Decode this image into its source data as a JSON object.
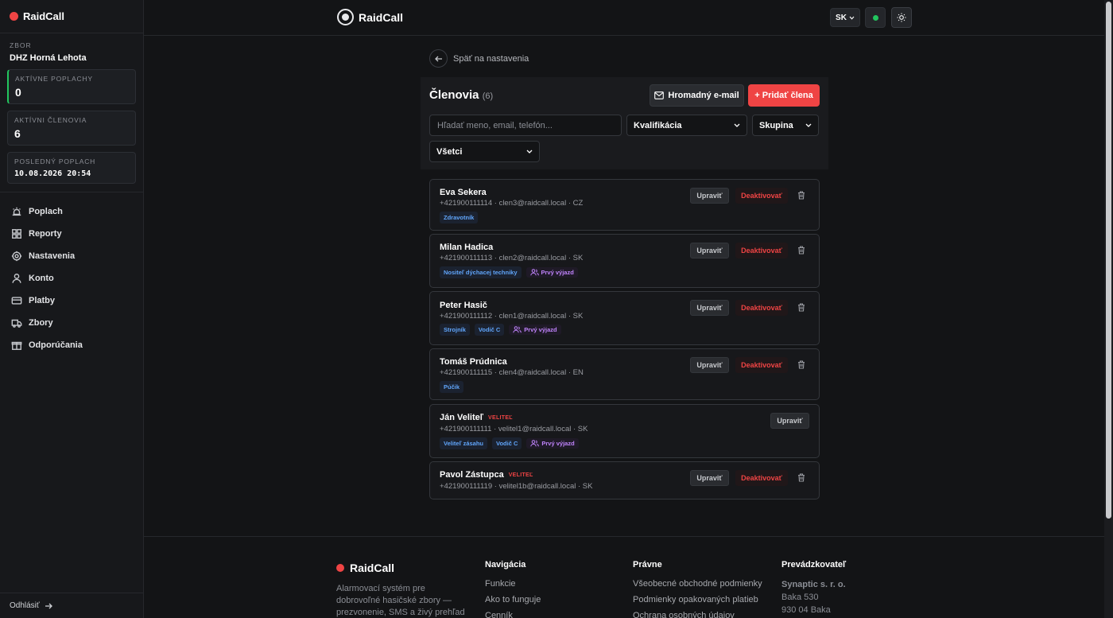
{
  "sidebar": {
    "brand": "RaidCall",
    "org_label": "ZBOR",
    "org_name": "DHZ Horná Lehota",
    "stats": [
      {
        "label": "AKTÍVNE POPLACHY",
        "value": "0"
      },
      {
        "label": "AKTÍVNI ČLENOVIA",
        "value": "6"
      },
      {
        "label": "POSLEDNÝ POPLACH",
        "value": "10.08.2026 20:54"
      }
    ],
    "nav": [
      {
        "label": "Poplach",
        "icon": "siren-icon"
      },
      {
        "label": "Reporty",
        "icon": "grid-icon"
      },
      {
        "label": "Nastavenia",
        "icon": "gear-icon"
      },
      {
        "label": "Konto",
        "icon": "user-icon"
      },
      {
        "label": "Platby",
        "icon": "card-icon"
      },
      {
        "label": "Zbory",
        "icon": "truck-icon"
      },
      {
        "label": "Odporúčania",
        "icon": "gift-icon"
      }
    ],
    "logout": "Odhlásiť"
  },
  "header": {
    "brand": "RaidCall",
    "lang": "SK",
    "status_color": "#22c55e"
  },
  "main": {
    "back_label": "Späť na nastavenia",
    "title": "Členovia",
    "count": "(6)",
    "mail_button": "Hromadný e-mail",
    "add_button": "+ Pridať člena",
    "search_placeholder": "Hľadať meno, email, telefón...",
    "filter_qualification": "Kvalifikácia",
    "filter_group": "Skupina",
    "filter_status": "Všetci",
    "edit_label": "Upraviť",
    "deactivate_label": "Deaktivovať",
    "first_response_label": "Prvý výjazd",
    "commander_badge": "VELITEĽ",
    "members": [
      {
        "name": "Eva Sekera",
        "info": "+421900111114 · clen3@raidcall.local · CZ",
        "tags": [
          "Zdravotník"
        ]
      },
      {
        "name": "Milan Hadica",
        "info": "+421900111113 · clen2@raidcall.local · SK",
        "tags": [
          "Nositeľ dýchacej techniky"
        ]
      },
      {
        "name": "Peter Hasič",
        "info": "+421900111112 · clen1@raidcall.local · SK",
        "tags": [
          "Strojník",
          "Vodič C"
        ]
      },
      {
        "name": "Tomáš Prúdnica",
        "info": "+421900111115 · clen4@raidcall.local · EN",
        "tags": [
          "Púčik"
        ]
      },
      {
        "name": "Ján Veliteľ",
        "info": "+421900111111 · velitel1@raidcall.local · SK",
        "tags": [
          "Veliteľ zásahu",
          "Vodič C"
        ]
      },
      {
        "name": "Pavol Zástupca",
        "info": "+421900111119 · velitel1b@raidcall.local · SK",
        "tags": []
      }
    ]
  },
  "footer": {
    "brand": "RaidCall",
    "description": "Alarmovací systém pre dobrovoľné hasičské zbory — prezvonenie, SMS a živý prehľad",
    "nav_title": "Navigácia",
    "nav_links": [
      "Funkcie",
      "Ako to funguje",
      "Cenník"
    ],
    "legal_title": "Právne",
    "legal_links": [
      "Všeobecné obchodné podmienky",
      "Podmienky opakovaných platieb",
      "Ochrana osobných údajov"
    ],
    "operator_title": "Prevádzkovateľ",
    "operator_name": "Synaptic s. r. o.",
    "operator_address1": "Baka 530",
    "operator_address2": "930 04 Baka"
  }
}
